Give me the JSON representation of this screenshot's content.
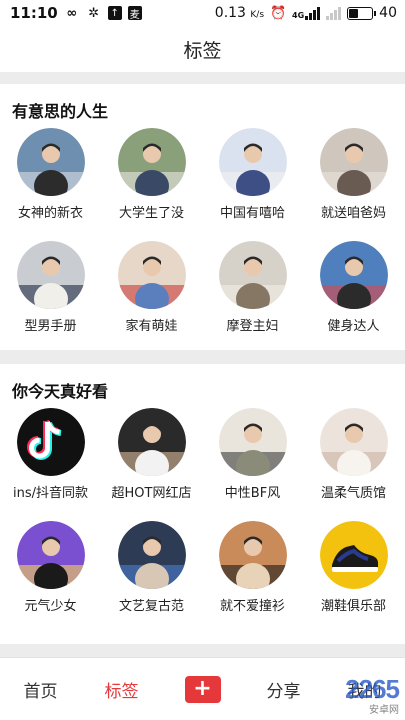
{
  "status_bar": {
    "time": "11:10",
    "left_icons": [
      "infinity-icon",
      "sync-icon",
      "upload-icon",
      "app-icon"
    ],
    "speed": "0.13",
    "speed_unit": "K/s",
    "network_label": "4G",
    "battery_level": "40",
    "battery_fraction": 0.4
  },
  "header": {
    "title": "标签"
  },
  "sections": [
    {
      "title": "有意思的人生",
      "items": [
        {
          "label": "女神的新衣",
          "colors": [
            "#6f8fb0",
            "#d9dde3",
            "#2c2c2c"
          ]
        },
        {
          "label": "大学生了没",
          "colors": [
            "#8aa07a",
            "#e9e6df",
            "#3a4a66"
          ]
        },
        {
          "label": "中国有嘻哈",
          "colors": [
            "#d9e2ee",
            "#f1f1f1",
            "#3e4f86"
          ]
        },
        {
          "label": "就送咱爸妈",
          "colors": [
            "#cfc6bd",
            "#eae5de",
            "#6a5b52"
          ]
        },
        {
          "label": "型男手册",
          "colors": [
            "#c9ccd1",
            "#1f2a44",
            "#f1efe9"
          ]
        },
        {
          "label": "家有萌娃",
          "colors": [
            "#e6d7c8",
            "#c93a3a",
            "#5b7fbd"
          ]
        },
        {
          "label": "摩登主妇",
          "colors": [
            "#d7d2c9",
            "#f2eee7",
            "#857764"
          ]
        },
        {
          "label": "健身达人",
          "colors": [
            "#4f7fbd",
            "#e04848",
            "#2b2b2b"
          ]
        }
      ]
    },
    {
      "title": "你今天真好看",
      "items": [
        {
          "label": "ins/抖音同款",
          "colors": [
            "#111111",
            "#25f4ee",
            "#fe2c55"
          ]
        },
        {
          "label": "超HOT网红店",
          "colors": [
            "#2a2a2a",
            "#d8b99a",
            "#f2f2f2"
          ]
        },
        {
          "label": "中性BF风",
          "colors": [
            "#e9e4dc",
            "#3c3c3c",
            "#8b8b7a"
          ]
        },
        {
          "label": "温柔气质馆",
          "colors": [
            "#ece4dc",
            "#c9b3a2",
            "#f7f3ee"
          ]
        },
        {
          "label": "元气少女",
          "colors": [
            "#7a4fd0",
            "#f5d35a",
            "#1a1a1a"
          ]
        },
        {
          "label": "文艺复古范",
          "colors": [
            "#2d3b55",
            "#4a7fd0",
            "#d8c7b5"
          ]
        },
        {
          "label": "就不爱撞衫",
          "colors": [
            "#c98b5a",
            "#1c1c1c",
            "#e8d3b8"
          ]
        },
        {
          "label": "潮鞋俱乐部",
          "colors": [
            "#f2c20f",
            "#1a1a1a",
            "#2a3b8f"
          ]
        }
      ]
    }
  ],
  "bottom_nav": {
    "items": [
      {
        "label": "首页"
      },
      {
        "label": "标签",
        "active": true
      },
      {
        "label": "+"
      },
      {
        "label": "分享"
      },
      {
        "label": "我的"
      }
    ]
  },
  "watermark": {
    "main": "2265",
    "sub": "安卓网"
  },
  "accent_color": "#e5383b"
}
